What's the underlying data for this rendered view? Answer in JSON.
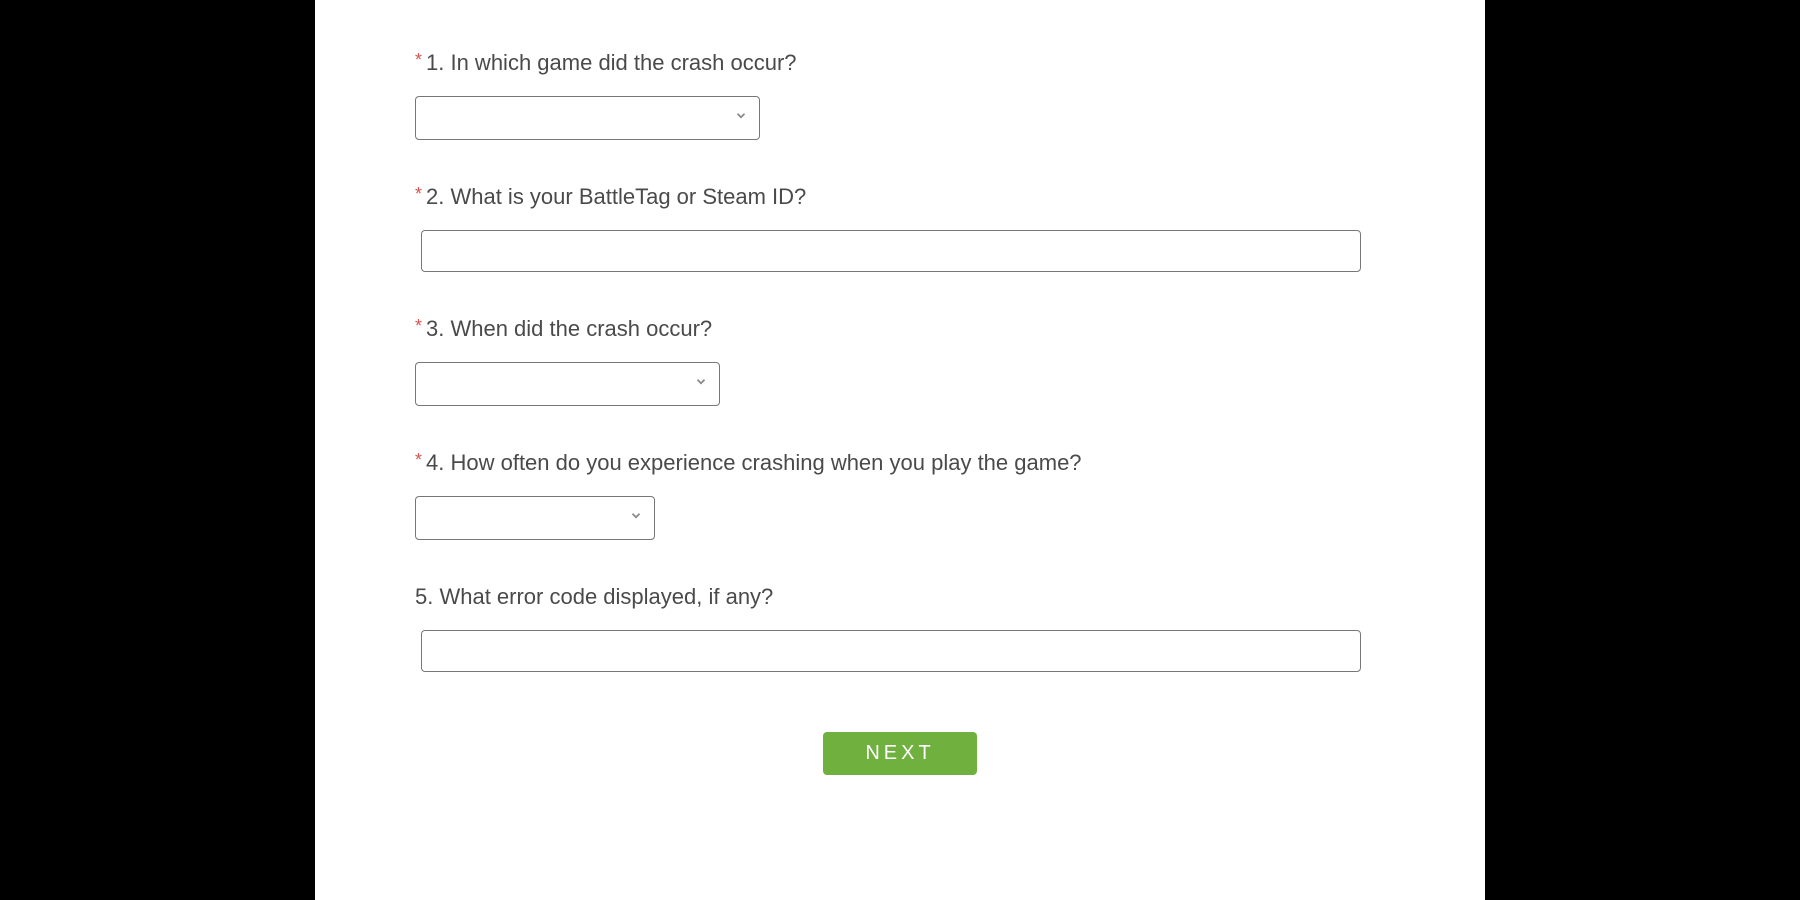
{
  "questions": {
    "q1": {
      "required": true,
      "label": "1. In which game did the crash occur?",
      "value": ""
    },
    "q2": {
      "required": true,
      "label": "2. What is your BattleTag or Steam ID?",
      "value": ""
    },
    "q3": {
      "required": true,
      "label": "3. When did the crash occur?",
      "value": ""
    },
    "q4": {
      "required": true,
      "label": "4. How often do you experience crashing when you play the game?",
      "value": ""
    },
    "q5": {
      "required": false,
      "label": "5. What error code displayed, if any?",
      "value": ""
    }
  },
  "buttons": {
    "next": "NEXT"
  },
  "required_marker": "*"
}
